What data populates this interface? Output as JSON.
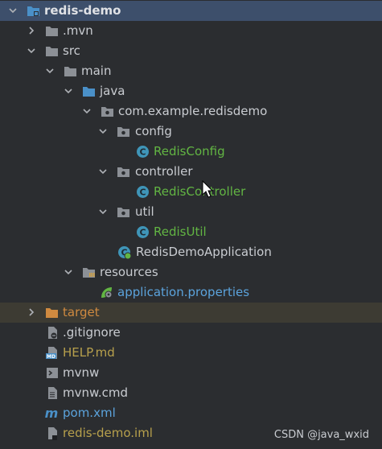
{
  "tree": {
    "root": "redis-demo",
    "mvn": ".mvn",
    "src": "src",
    "main": "main",
    "java": "java",
    "package": "com.example.redisdemo",
    "config": "config",
    "redis_config": "RedisConfig",
    "controller": "controller",
    "redis_controller": "RedisController",
    "util": "util",
    "redis_util": "RedisUtil",
    "app": "RedisDemoApplication",
    "resources": "resources",
    "app_props": "application.properties",
    "target": "target",
    "gitignore": ".gitignore",
    "help": "HELP.md",
    "mvnw": "mvnw",
    "mvnw_cmd": "mvnw.cmd",
    "pom": "pom.xml",
    "iml": "redis-demo.iml"
  },
  "watermark": "CSDN @java_wxid",
  "colors": {
    "background": "#2b2d30",
    "selected_row": "#3d4f6b",
    "excluded_row": "#3d3b33",
    "folder": "#8c9096",
    "source_folder": "#4a90c8",
    "class_icon": "#3f95b8",
    "green_text": "#62b543",
    "olive_text": "#b7a04c",
    "orange_text": "#d08a40",
    "blue_text": "#5ba3dc"
  }
}
